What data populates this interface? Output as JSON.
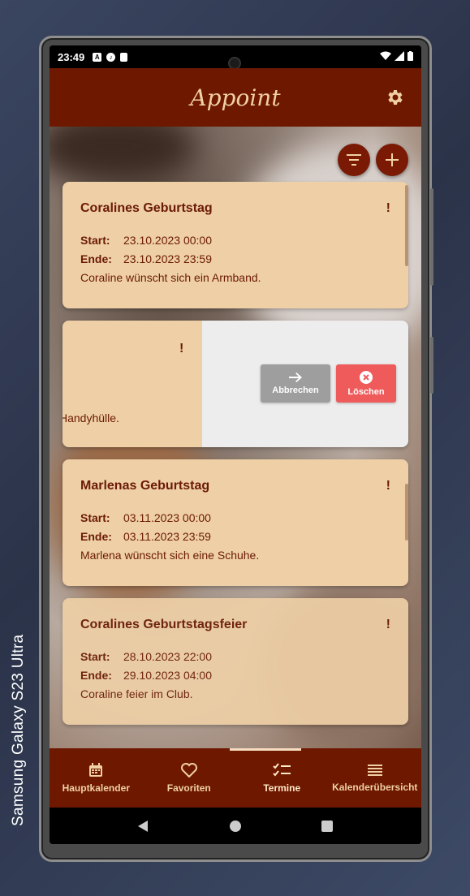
{
  "device_label": "Samsung Galaxy  S23 Ultra",
  "status_bar": {
    "time": "23:49"
  },
  "app": {
    "title": "Appoint"
  },
  "cards": [
    {
      "title": "Coralines Geburtstag",
      "flag": "!",
      "start_label": "Start:",
      "start": "23.10.2023 00:00",
      "end_label": "Ende:",
      "end": "23.10.2023 23:59",
      "description": "Coraline wünscht sich ein Armband."
    },
    {
      "title": "Marlenas Geburtstag",
      "flag": "!",
      "start_label": "Start:",
      "start": "03.11.2023 00:00",
      "end_label": "Ende:",
      "end": "03.11.2023 23:59",
      "description": "Marlena wünscht sich eine Schuhe."
    },
    {
      "title": "Coralines Geburtstagsfeier",
      "flag": "!",
      "start_label": "Start:",
      "start": "28.10.2023 22:00",
      "end_label": "Ende:",
      "end": "29.10.2023 04:00",
      "description": "Coraline feier im Club."
    }
  ],
  "swiped_card": {
    "flag": "!",
    "description_partial": "Handyhülle.",
    "cancel_label": "Abbrechen",
    "delete_label": "Löschen"
  },
  "bottom_nav": {
    "items": [
      {
        "label": "Hauptkalender",
        "icon": "calendar-icon"
      },
      {
        "label": "Favoriten",
        "icon": "heart-icon"
      },
      {
        "label": "Termine",
        "icon": "checklist-icon",
        "active": true
      },
      {
        "label": "Kalenderübersicht",
        "icon": "list-icon"
      }
    ]
  },
  "colors": {
    "brand": "#6e1800",
    "card": "#eecfa6",
    "text": "#6b1a05",
    "cancel": "#9e9e9e",
    "delete": "#ef5a5a"
  }
}
